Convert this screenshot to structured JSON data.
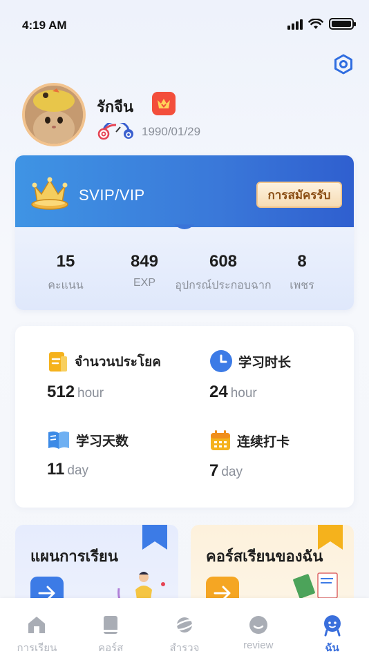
{
  "status_bar": {
    "time": "4:19 AM"
  },
  "profile": {
    "name": "รักจีน",
    "birthday": "1990/01/29"
  },
  "vip": {
    "label": "SVIP/VIP",
    "subscribe_label": "การสมัครรับ",
    "stats": [
      {
        "value": "15",
        "label": "คะแนน"
      },
      {
        "value": "849",
        "label": "EXP"
      },
      {
        "value": "608",
        "label": "อุปกรณ์ประกอบฉาก"
      },
      {
        "value": "8",
        "label": "เพชร"
      }
    ]
  },
  "study": {
    "metrics": [
      {
        "title": "จำนวนประโยค",
        "value": "512",
        "unit": "hour",
        "icon": "document-icon",
        "color": "#f5b21c"
      },
      {
        "title": "学习时长",
        "value": "24",
        "unit": "hour",
        "icon": "clock-icon",
        "color": "#3c7be6"
      },
      {
        "title": "学习天数",
        "value": "11",
        "unit": "day",
        "icon": "book-icon",
        "color": "#3c8ae6"
      },
      {
        "title": "连续打卡",
        "value": "7",
        "unit": "day",
        "icon": "calendar-icon",
        "color": "#f5b21c"
      }
    ]
  },
  "cards": {
    "plan_title": "แผนการเรียน",
    "course_title": "คอร์สเรียนของฉัน"
  },
  "tabs": [
    {
      "label": "การเรียน",
      "icon": "home-icon"
    },
    {
      "label": "คอร์ส",
      "icon": "book-icon"
    },
    {
      "label": "สำรวจ",
      "icon": "planet-icon"
    },
    {
      "label": "review",
      "icon": "chat-icon"
    },
    {
      "label": "ฉัน",
      "icon": "profile-icon",
      "active": true
    }
  ],
  "colors": {
    "accent": "#3a6fdc",
    "vip_band": "#3a78d9",
    "gold": "#f5b21c",
    "badge_red": "#f34e3b"
  }
}
